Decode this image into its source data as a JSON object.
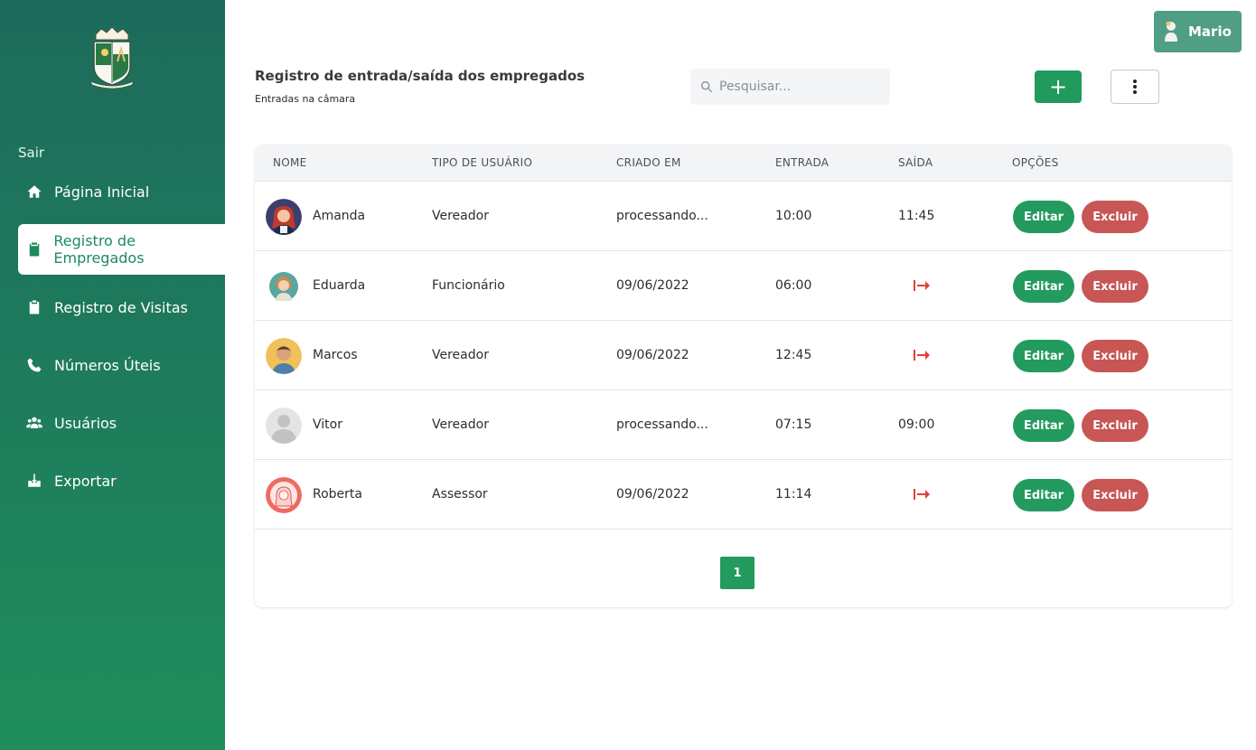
{
  "sidebar": {
    "logout_label": "Sair",
    "items": [
      {
        "label": "Página Inicial",
        "icon": "home-icon"
      },
      {
        "label": "Registro de Empregados",
        "icon": "clipboard-list-icon"
      },
      {
        "label": "Registro de Visitas",
        "icon": "clipboard-icon"
      },
      {
        "label": "Números Úteis",
        "icon": "phone-icon"
      },
      {
        "label": "Usuários",
        "icon": "users-icon"
      },
      {
        "label": "Exportar",
        "icon": "download-icon"
      }
    ],
    "active_index": 1
  },
  "header": {
    "user_name": "Mario",
    "title": "Registro de entrada/saída dos empregados",
    "subtitle": "Entradas na câmara",
    "search_placeholder": "Pesquisar...",
    "add_label": "+"
  },
  "table": {
    "columns": [
      "NOME",
      "TIPO DE USUÁRIO",
      "CRIADO EM",
      "ENTRADA",
      "SAÍDA",
      "OPÇÕES"
    ],
    "rows": [
      {
        "name": "Amanda",
        "type": "Vereador",
        "created": "processando...",
        "entry": "10:00",
        "exit": "11:45"
      },
      {
        "name": "Eduarda",
        "type": "Funcionário",
        "created": "09/06/2022",
        "entry": "06:00",
        "exit": ""
      },
      {
        "name": "Marcos",
        "type": "Vereador",
        "created": "09/06/2022",
        "entry": "12:45",
        "exit": ""
      },
      {
        "name": "Vitor",
        "type": "Vereador",
        "created": "processando...",
        "entry": "07:15",
        "exit": "09:00"
      },
      {
        "name": "Roberta",
        "type": "Assessor",
        "created": "09/06/2022",
        "entry": "11:14",
        "exit": ""
      }
    ],
    "edit_label": "Editar",
    "delete_label": "Excluir"
  },
  "pagination": {
    "current_page": "1"
  },
  "colors": {
    "brand_green": "#219a5c",
    "danger_red": "#c75655",
    "exit_icon_red": "#e0403c"
  }
}
